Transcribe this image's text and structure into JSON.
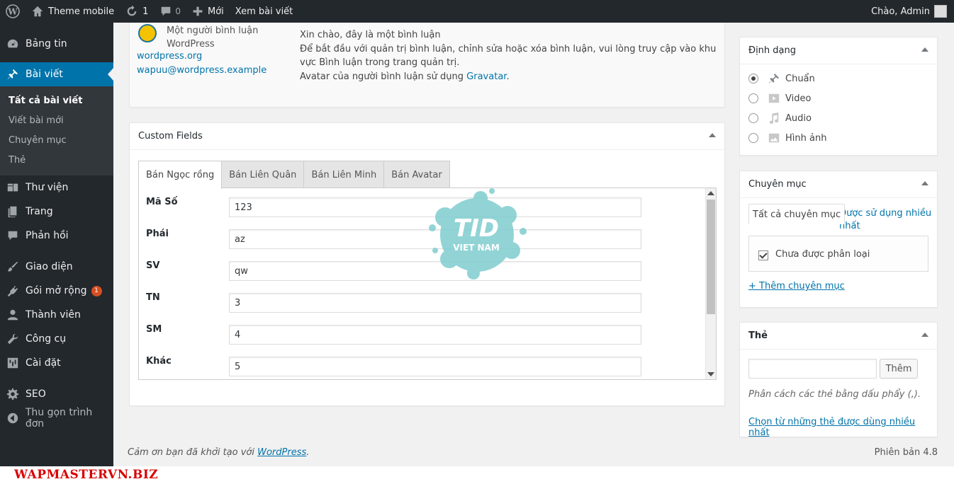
{
  "adminbar": {
    "site_name": "Theme mobile",
    "updates_count": "1",
    "comments_count": "0",
    "new_label": "Mới",
    "view_post_label": "Xem bài viết",
    "greeting": "Chào, Admin"
  },
  "sidebar": {
    "items": [
      {
        "label": "Bảng tin",
        "icon": "dashboard-icon"
      },
      {
        "label": "Bài viết",
        "icon": "pin-icon"
      },
      {
        "label": "Thư viện",
        "icon": "media-icon"
      },
      {
        "label": "Trang",
        "icon": "page-icon"
      },
      {
        "label": "Phản hồi",
        "icon": "comment-icon"
      },
      {
        "label": "Giao diện",
        "icon": "brush-icon"
      },
      {
        "label": "Gói mở rộng",
        "icon": "plugin-icon",
        "badge": "1"
      },
      {
        "label": "Thành viên",
        "icon": "user-icon"
      },
      {
        "label": "Công cụ",
        "icon": "wrench-icon"
      },
      {
        "label": "Cài đặt",
        "icon": "settings-icon"
      },
      {
        "label": "SEO",
        "icon": "gear-icon"
      },
      {
        "label": "Thu gọn trình đơn",
        "icon": "collapse-icon"
      }
    ],
    "submenu": [
      "Tất cả bài viết",
      "Viết bài mới",
      "Chuyên mục",
      "Thẻ"
    ]
  },
  "comment": {
    "author_name": "Một người bình luận WordPress",
    "author_url": "wordpress.org",
    "author_email": "wapuu@wordpress.example",
    "line1": "Xin chào, đây là một bình luận",
    "line2": "Để bắt đầu với quản trị bình luận, chỉnh sửa hoặc xóa bình luận, vui lòng truy cập vào khu vực Bình luận trong trang quản trị.",
    "line3_prefix": "Avatar của người bình luận sử dụng ",
    "line3_link": "Gravatar",
    "line3_suffix": "."
  },
  "custom_fields": {
    "title": "Custom Fields",
    "tabs": [
      "Bán Ngọc rồng",
      "Bán Liên Quân",
      "Bán Liên Minh",
      "Bán Avatar"
    ],
    "fields": [
      {
        "label": "Mã Số",
        "value": "123"
      },
      {
        "label": "Phái",
        "value": "az"
      },
      {
        "label": "SV",
        "value": "qw"
      },
      {
        "label": "TN",
        "value": "3"
      },
      {
        "label": "SM",
        "value": "4"
      },
      {
        "label": "Khác",
        "value": "5"
      }
    ]
  },
  "watermark": {
    "text1": "TID",
    "text2": "VIET NAM"
  },
  "format_box": {
    "title": "Định dạng",
    "options": [
      {
        "label": "Chuẩn",
        "checked": true
      },
      {
        "label": "Video",
        "checked": false
      },
      {
        "label": "Audio",
        "checked": false
      },
      {
        "label": "Hình ảnh",
        "checked": false
      }
    ]
  },
  "category_box": {
    "title": "Chuyên mục",
    "tab_all": "Tất cả chuyên mục",
    "tab_popular": "Được sử dụng nhiều nhất",
    "category": "Chưa được phân loại",
    "add_link": "+ Thêm chuyên mục"
  },
  "tag_box": {
    "title": "Thẻ",
    "add_button": "Thêm",
    "hint": "Phân cách các thẻ bằng dấu phẩy (,).",
    "choose_link": "Chọn từ những thẻ được dùng nhiều nhất"
  },
  "footer": {
    "thanks_prefix": "Cảm ơn bạn đã khởi tạo với ",
    "thanks_link": "WordPress",
    "thanks_suffix": ".",
    "version": "Phiên bản 4.8"
  },
  "brand_watermark": "WAPMASTERVN.BIZ"
}
